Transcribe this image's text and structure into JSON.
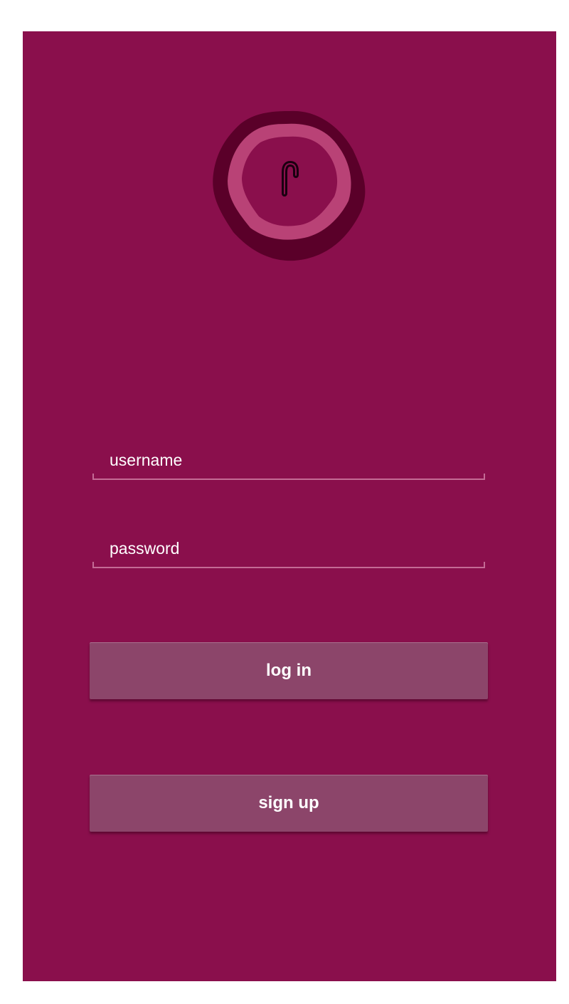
{
  "logo": {
    "icon": "logo-swirl-icon",
    "ring_outer_color": "#5a0029",
    "ring_inner_color": "#b94276"
  },
  "login_form": {
    "username": {
      "placeholder": "username",
      "value": ""
    },
    "password": {
      "placeholder": "password",
      "value": ""
    },
    "login_button_label": "log in",
    "signup_button_label": "sign up"
  },
  "theme": {
    "background": "#8a0f4c",
    "button": "#8c456a",
    "text": "#ffffff"
  }
}
